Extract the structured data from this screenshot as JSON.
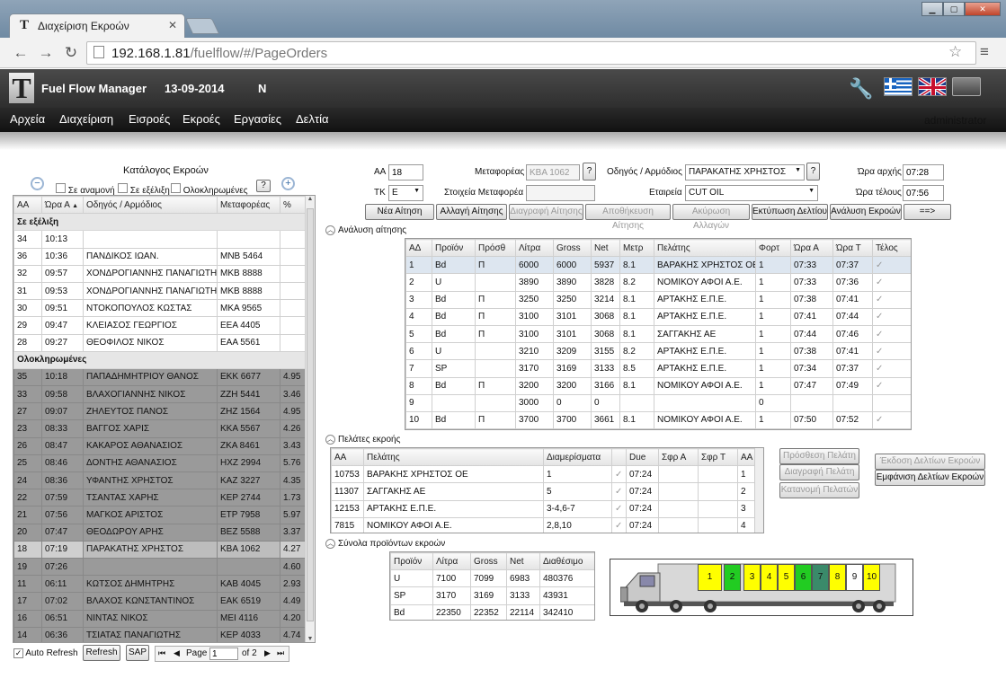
{
  "browser": {
    "tab_title": "Διαχείριση Εκροών",
    "url_host": "192.168.1.81",
    "url_path": "/fuelflow/#/PageOrders"
  },
  "app": {
    "title": "Fuel Flow Manager",
    "date": "13-09-2014",
    "mode": "N",
    "user": "administrator",
    "menu": [
      "Αρχεία",
      "Διαχείριση",
      "Εισροές",
      "Εκροές",
      "Εργασίες",
      "Δελτία"
    ]
  },
  "left": {
    "title": "Κατάλογος Εκροών",
    "filters": [
      "Σε αναμονή",
      "Σε εξέλιξη",
      "Ολοκληρωμένες"
    ],
    "help": "?",
    "columns": [
      "ΑΑ",
      "Ώρα Α",
      "Οδηγός / Αρμόδιος",
      "Μεταφορέας",
      "%"
    ],
    "sort_marker": "▲",
    "group_inprogress": "Σε εξέλιξη",
    "group_completed": "Ολοκληρωμένες",
    "inprogress": [
      [
        "34",
        "10:13",
        "",
        "",
        ""
      ],
      [
        "36",
        "10:36",
        "ΠΑΝΔΙΚΟΣ ΙΩΑΝ.",
        "ΜΝΒ 5464",
        ""
      ],
      [
        "32",
        "09:57",
        "ΧΟΝΔΡΟΓΙΑΝΝΗΣ ΠΑΝΑΓΙΩΤΗΣ",
        "ΜΚΒ 8888",
        ""
      ],
      [
        "31",
        "09:53",
        "ΧΟΝΔΡΟΓΙΑΝΝΗΣ ΠΑΝΑΓΙΩΤΗΣ",
        "ΜΚΒ 8888",
        ""
      ],
      [
        "30",
        "09:51",
        "ΝΤΟΚΟΠΟΥΛΟΣ ΚΩΣΤΑΣ",
        "ΜΚΑ 9565",
        ""
      ],
      [
        "29",
        "09:47",
        "ΚΛΕΙΑΣΟΣ ΓΕΩΡΓΙΟΣ",
        "ΕΕΑ 4405",
        ""
      ],
      [
        "28",
        "09:27",
        "ΘΕΟΦΙΛΟΣ ΝΙΚΟΣ",
        "ΕΑΑ 5561",
        ""
      ]
    ],
    "completed": [
      [
        "35",
        "10:18",
        "ΠΑΠΑΔΗΜΗΤΡΙΟΥ ΘΑΝΟΣ",
        "ΕΚΚ 6677",
        "4.95"
      ],
      [
        "33",
        "09:58",
        "ΒΛΑΧΟΓΙΑΝΝΗΣ ΝΙΚΟΣ",
        "ΖΖΗ 5441",
        "3.46"
      ],
      [
        "27",
        "09:07",
        "ΖΗΛΕΥΤΟΣ ΠΑΝΟΣ",
        "ΖΗΖ 1564",
        "4.95"
      ],
      [
        "23",
        "08:33",
        "ΒΑΓΓΟΣ ΧΑΡΙΣ",
        "ΚΚΑ 5567",
        "4.26"
      ],
      [
        "26",
        "08:47",
        "ΚΑΚΑΡΟΣ ΑΘΑΝΑΣΙΟΣ",
        "ΖΚΑ 8461",
        "3.43"
      ],
      [
        "25",
        "08:46",
        "ΔΟΝΤΗΣ ΑΘΑΝΑΣΙΟΣ",
        "ΗΧΖ 2994",
        "5.76"
      ],
      [
        "24",
        "08:36",
        "ΥΦΑΝΤΗΣ ΧΡΗΣΤΟΣ",
        "ΚΑΖ 3227",
        "4.35"
      ],
      [
        "22",
        "07:59",
        "ΤΣΑΝΤΑΣ ΧΑΡΗΣ",
        "ΚΕΡ 2744",
        "1.73"
      ],
      [
        "21",
        "07:56",
        "ΜΑΓΚΟΣ ΑΡΙΣΤΟΣ",
        "ΕΤΡ 7958",
        "5.97"
      ],
      [
        "20",
        "07:47",
        "ΘΕΟΔΩΡΟΥ ΑΡΗΣ",
        "ΒΕΖ 5588",
        "3.37"
      ],
      [
        "18",
        "07:19",
        "ΠΑΡΑΚΑΤΗΣ ΧΡΗΣΤΟΣ",
        "ΚΒΑ 1062",
        "4.27"
      ],
      [
        "19",
        "07:26",
        "",
        "",
        "4.60"
      ],
      [
        "11",
        "06:11",
        "ΚΩΤΣΟΣ ΔΗΜΗΤΡΗΣ",
        "ΚΑΒ 4045",
        "2.93"
      ],
      [
        "17",
        "07:02",
        "ΒΛΑΧΟΣ ΚΩΝΣΤΑΝΤΙΝΟΣ",
        "ΕΑΚ 6519",
        "4.49"
      ],
      [
        "16",
        "06:51",
        "ΝΙΝΤΑΣ ΝΙΚΟΣ",
        "ΜΕΙ 4116",
        "4.20"
      ],
      [
        "14",
        "06:36",
        "ΤΣΙΑΤΑΣ ΠΑΝΑΓΙΩΤΗΣ",
        "ΚΕΡ 4033",
        "4.74"
      ]
    ],
    "auto_refresh_label": "Auto Refresh",
    "refresh_label": "Refresh",
    "sap_label": "SAP",
    "page_label": "Page",
    "page_value": "1",
    "page_of": "of 2"
  },
  "form": {
    "aa_label": "ΑΑ",
    "aa_value": "18",
    "tk_label": "ΤΚ",
    "tk_value": "Ε",
    "carrier_label": "Μεταφορέας",
    "carrier_value": "ΚΒΑ 1062",
    "carrier_info_label": "Στοιχεία Μεταφορέα",
    "carrier_info_value": "",
    "driver_label": "Οδηγός / Αρμόδιος",
    "driver_value": "ΠΑΡΑΚΑΤΗΣ ΧΡΗΣΤΟΣ",
    "company_label": "Εταιρεία",
    "company_value": "CUT OIL",
    "start_label": "Ώρα αρχής",
    "start_value": "07:28",
    "end_label": "Ώρα τέλους",
    "end_value": "07:56",
    "help": "?"
  },
  "actions": {
    "new": "Νέα Αίτηση",
    "change": "Αλλαγή Αίτησης",
    "delete": "Διαγραφή Αίτησης",
    "save": "Αποθήκευση Αίτησης",
    "cancel": "Ακύρωση Αλλαγών",
    "print": "Εκτύπωση Δελτίου",
    "analysis": "Ανάλυση Εκροών",
    "next": "==>"
  },
  "analysis": {
    "section_title": "Ανάλυση αίτησης",
    "columns": [
      "ΑΔ",
      "Προϊόν",
      "Πρόσθ",
      "Λίτρα",
      "Gross",
      "Net",
      "Μετρ",
      "Πελάτης",
      "Φορτ",
      "Ώρα Α",
      "Ώρα Τ",
      "Τέλος"
    ],
    "rows": [
      [
        "1",
        "Bd",
        "Π",
        "6000",
        "6000",
        "5937",
        "8.1",
        "ΒΑΡΑΚΗΣ ΧΡΗΣΤΟΣ ΟΕ",
        "1",
        "07:33",
        "07:37",
        "✓"
      ],
      [
        "2",
        "U",
        "",
        "3890",
        "3890",
        "3828",
        "8.2",
        "ΝΟΜΙΚΟΥ ΑΦΟΙ Α.Ε.",
        "1",
        "07:33",
        "07:36",
        "✓"
      ],
      [
        "3",
        "Bd",
        "Π",
        "3250",
        "3250",
        "3214",
        "8.1",
        "ΑΡΤΑΚΗΣ Ε.Π.Ε.",
        "1",
        "07:38",
        "07:41",
        "✓"
      ],
      [
        "4",
        "Bd",
        "Π",
        "3100",
        "3101",
        "3068",
        "8.1",
        "ΑΡΤΑΚΗΣ Ε.Π.Ε.",
        "1",
        "07:41",
        "07:44",
        "✓"
      ],
      [
        "5",
        "Bd",
        "Π",
        "3100",
        "3101",
        "3068",
        "8.1",
        "ΣΑΓΓΑΚΗΣ ΑΕ",
        "1",
        "07:44",
        "07:46",
        "✓"
      ],
      [
        "6",
        "U",
        "",
        "3210",
        "3209",
        "3155",
        "8.2",
        "ΑΡΤΑΚΗΣ Ε.Π.Ε.",
        "1",
        "07:38",
        "07:41",
        "✓"
      ],
      [
        "7",
        "SP",
        "",
        "3170",
        "3169",
        "3133",
        "8.5",
        "ΑΡΤΑΚΗΣ Ε.Π.Ε.",
        "1",
        "07:34",
        "07:37",
        "✓"
      ],
      [
        "8",
        "Bd",
        "Π",
        "3200",
        "3200",
        "3166",
        "8.1",
        "ΝΟΜΙΚΟΥ ΑΦΟΙ Α.Ε.",
        "1",
        "07:47",
        "07:49",
        "✓"
      ],
      [
        "9",
        "",
        "",
        "3000",
        "0",
        "0",
        "",
        "",
        "0",
        "",
        "",
        ""
      ],
      [
        "10",
        "Bd",
        "Π",
        "3700",
        "3700",
        "3661",
        "8.1",
        "ΝΟΜΙΚΟΥ ΑΦΟΙ Α.Ε.",
        "1",
        "07:50",
        "07:52",
        "✓"
      ]
    ]
  },
  "customers": {
    "section_title": "Πελάτες εκροής",
    "columns": [
      "ΑΑ",
      "Πελάτης",
      "Διαμερίσματα",
      "",
      "Due",
      "Σφρ Α",
      "Σφρ Τ",
      "ΑΑ ▲"
    ],
    "rows": [
      [
        "10753",
        "ΒΑΡΑΚΗΣ ΧΡΗΣΤΟΣ ΟΕ",
        "1",
        "✓",
        "07:24",
        "",
        "",
        "1"
      ],
      [
        "11307",
        "ΣΑΓΓΑΚΗΣ ΑΕ",
        "5",
        "✓",
        "07:24",
        "",
        "",
        "2"
      ],
      [
        "12153",
        "ΑΡΤΑΚΗΣ Ε.Π.Ε.",
        "3-4,6-7",
        "✓",
        "07:24",
        "",
        "",
        "3"
      ],
      [
        "7815",
        "ΝΟΜΙΚΟΥ ΑΦΟΙ Α.Ε.",
        "2,8,10",
        "✓",
        "07:24",
        "",
        "",
        "4"
      ]
    ],
    "add": "Πρόσθεση Πελάτη",
    "remove": "Διαγραφή Πελάτη",
    "distribute": "Κατανομή Πελατών",
    "issue": "Έκδοση Δελτίων Εκροών",
    "show": "Εμφάνιση Δελτίων Εκροών"
  },
  "totals": {
    "section_title": "Σύνολα προϊόντων εκροών",
    "columns": [
      "Προϊόν",
      "Λίτρα",
      "Gross",
      "Net",
      "Διαθέσιμο"
    ],
    "rows": [
      [
        "U",
        "7100",
        "7099",
        "6983",
        "480376"
      ],
      [
        "SP",
        "3170",
        "3169",
        "3133",
        "43931"
      ],
      [
        "Bd",
        "22350",
        "22352",
        "22114",
        "342410"
      ]
    ]
  },
  "truck": {
    "compartments": [
      {
        "n": "1",
        "color": "#ffff00"
      },
      {
        "n": "2",
        "color": "#22cc22"
      },
      {
        "n": "3",
        "color": "#ffff00"
      },
      {
        "n": "4",
        "color": "#ffff00"
      },
      {
        "n": "5",
        "color": "#ffff00"
      },
      {
        "n": "6",
        "color": "#22cc22"
      },
      {
        "n": "7",
        "color": "#3a8a6a"
      },
      {
        "n": "8",
        "color": "#ffff00"
      },
      {
        "n": "9",
        "color": "#ffffff"
      },
      {
        "n": "10",
        "color": "#ffff00"
      }
    ]
  }
}
